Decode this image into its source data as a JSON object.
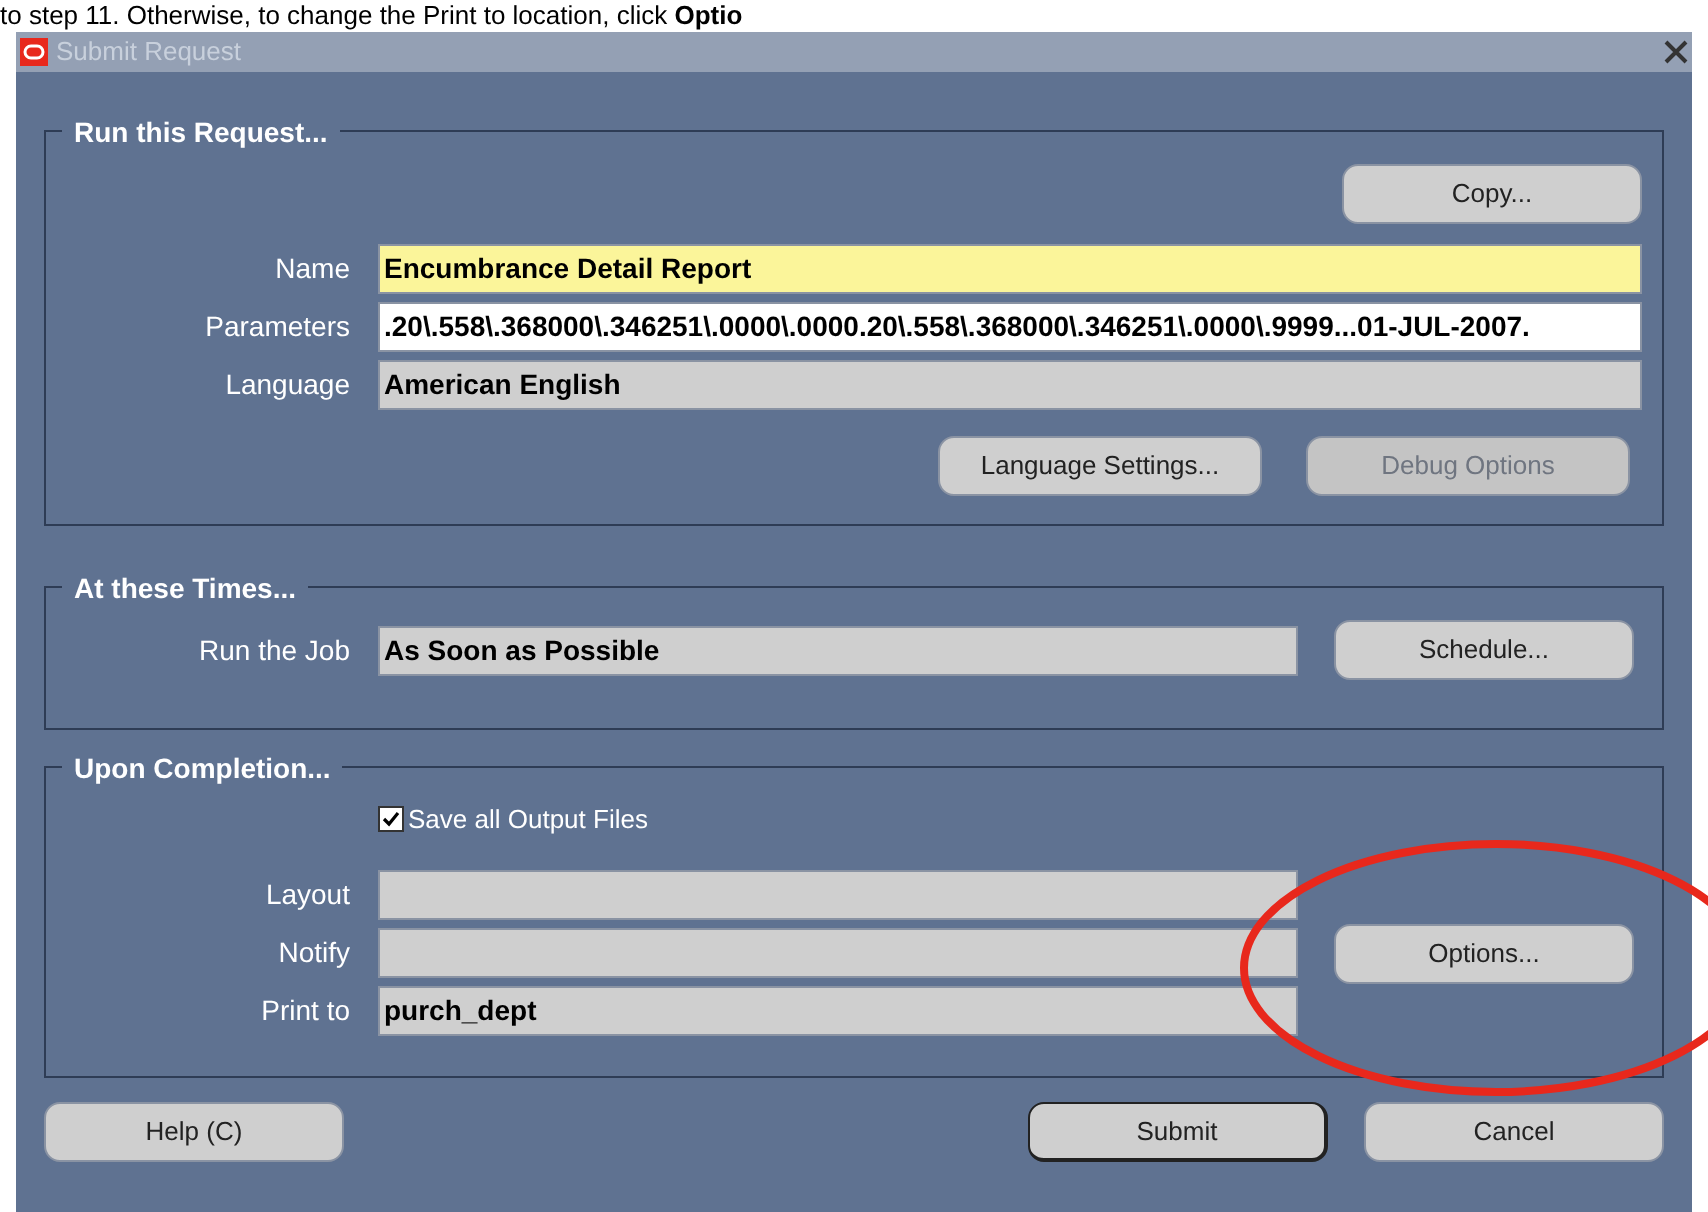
{
  "doc_text": "to step 11. Otherwise, to change the Print to location, click **Optio**",
  "window": {
    "title": "Submit Request"
  },
  "run_request": {
    "heading": "Run this Request...",
    "copy_button": "Copy...",
    "fields": [
      {
        "label": "Name",
        "value": "Encumbrance Detail Report",
        "kind": "required"
      },
      {
        "label": "Parameters",
        "value": ".20\\.558\\.368000\\.346251\\.0000\\.0000.20\\.558\\.368000\\.346251\\.0000\\.9999...01-JUL-2007.",
        "kind": "editable"
      },
      {
        "label": "Language",
        "value": "American English",
        "kind": "readonly"
      }
    ],
    "buttons": [
      {
        "label": "Language Settings...",
        "disabled": false
      },
      {
        "label": "Debug Options",
        "disabled": true
      }
    ]
  },
  "at_times": {
    "heading": "At these Times...",
    "label": "Run the Job",
    "value": "As Soon as Possible",
    "button": "Schedule..."
  },
  "completion": {
    "heading": "Upon Completion...",
    "save_outputs": {
      "label": "Save all Output Files",
      "checked": true
    },
    "fields": [
      {
        "label": "Layout"
      },
      {
        "label": "Notify"
      },
      {
        "label": "Print to",
        "value": "purch_dept"
      }
    ],
    "button": "Options...",
    "highlighted": true
  },
  "footer": {
    "help": "Help (C)",
    "submit": "Submit",
    "cancel": "Cancel"
  }
}
